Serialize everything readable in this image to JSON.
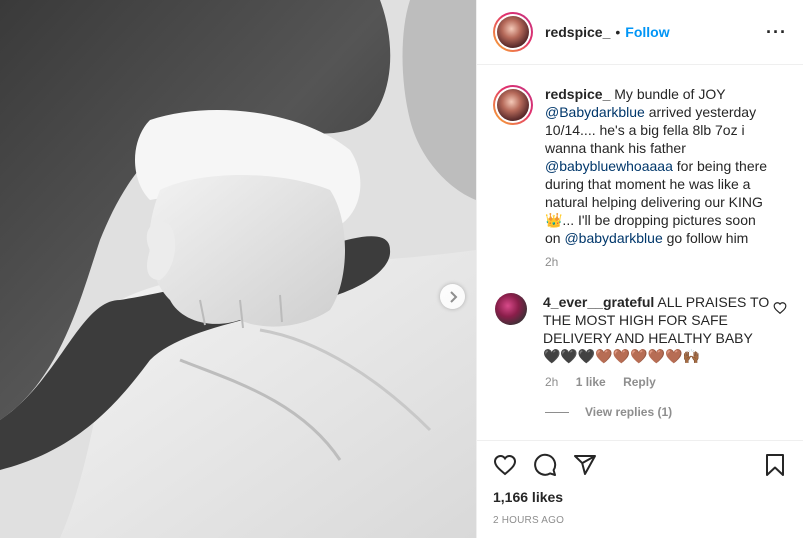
{
  "post": {
    "author": "redspice_",
    "separator": "•",
    "follow_label": "Follow",
    "more_label": "···"
  },
  "caption": {
    "user": "redspice_",
    "text_1": " My bundle of JOY ",
    "mention_1": "@Babydarkblue",
    "text_2": " arrived yesterday 10/14.... he's a big fella 8lb 7oz i wanna thank his father ",
    "mention_2": "@babybluewhoaaaa",
    "text_3": " for being there during that moment he was like a natural helping delivering our KING 👑... I'll be dropping pictures soon on ",
    "mention_3": "@babydarkblue",
    "text_4": " go follow him",
    "time": "2h"
  },
  "comment": {
    "user": "4_ever__grateful",
    "text": " ALL PRAISES TO THE MOST HIGH FOR SAFE DELIVERY AND HEALTHY BABY 🖤🖤🖤🤎🤎🤎🤎🤎🙌🏾",
    "time": "2h",
    "likes": "1 like",
    "reply_label": "Reply",
    "view_replies": "View replies (1)"
  },
  "footer": {
    "likes": "1,166 likes",
    "time_ago": "2 HOURS AGO"
  },
  "icons": {
    "like": "heart-icon",
    "comment": "comment-icon",
    "share": "share-icon",
    "save": "bookmark-icon",
    "next": "chevron-right-icon",
    "comment_like": "heart-icon"
  },
  "colors": {
    "accent": "#0095f6",
    "mention": "#00376b",
    "muted": "#8e8e8e",
    "text": "#262626"
  }
}
